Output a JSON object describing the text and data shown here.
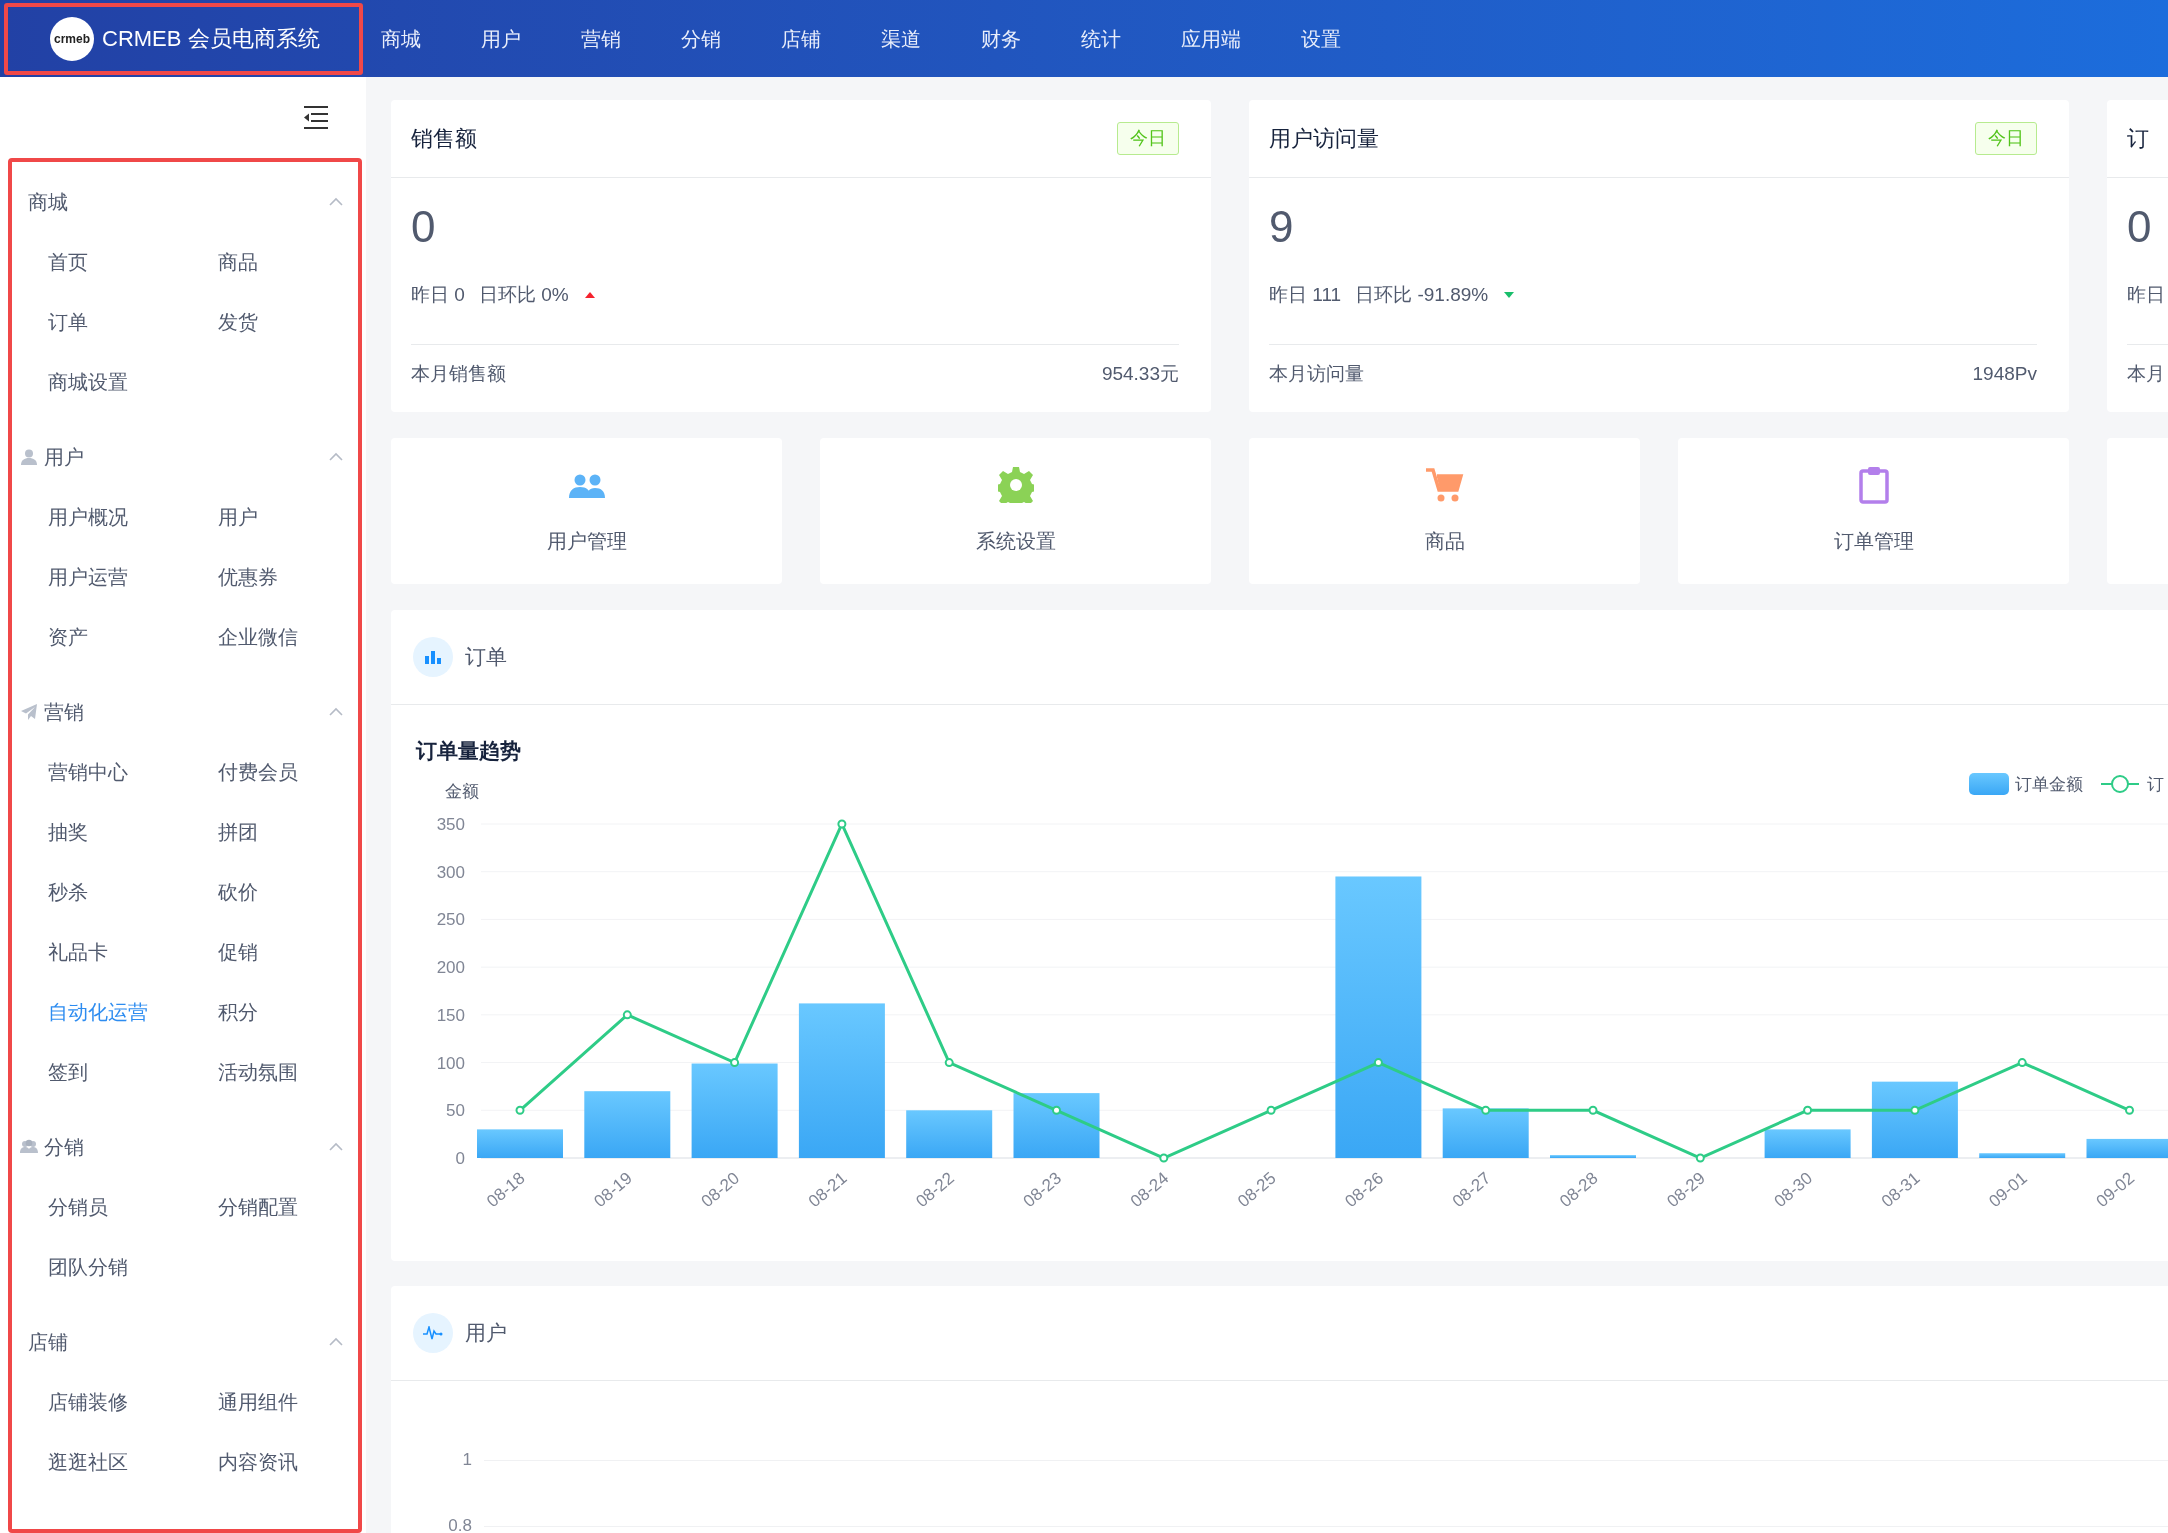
{
  "header": {
    "logo_text": "crmeb",
    "title": "CRMEB 会员电商系统",
    "highlighted": true,
    "nav": [
      "商城",
      "用户",
      "营销",
      "分销",
      "店铺",
      "渠道",
      "财务",
      "统计",
      "应用端",
      "设置"
    ]
  },
  "sidebar": {
    "highlighted": true,
    "groups": [
      {
        "title": "商城",
        "expanded": true,
        "items": [
          {
            "label": "首页",
            "selected": false
          },
          {
            "label": "商品",
            "selected": false
          },
          {
            "label": "订单",
            "selected": false
          },
          {
            "label": "发货",
            "selected": false
          },
          {
            "label": "商城设置",
            "selected": false
          }
        ]
      },
      {
        "title": "用户",
        "expanded": true,
        "items": [
          {
            "label": "用户概况",
            "selected": false
          },
          {
            "label": "用户",
            "selected": false
          },
          {
            "label": "用户运营",
            "selected": false
          },
          {
            "label": "优惠券",
            "selected": false
          },
          {
            "label": "资产",
            "selected": false
          },
          {
            "label": "企业微信",
            "selected": false
          }
        ]
      },
      {
        "title": "营销",
        "expanded": true,
        "items": [
          {
            "label": "营销中心",
            "selected": false
          },
          {
            "label": "付费会员",
            "selected": false
          },
          {
            "label": "抽奖",
            "selected": false
          },
          {
            "label": "拼团",
            "selected": false
          },
          {
            "label": "秒杀",
            "selected": false
          },
          {
            "label": "砍价",
            "selected": false
          },
          {
            "label": "礼品卡",
            "selected": false
          },
          {
            "label": "促销",
            "selected": false
          },
          {
            "label": "自动化运营",
            "selected": true
          },
          {
            "label": "积分",
            "selected": false
          },
          {
            "label": "签到",
            "selected": false
          },
          {
            "label": "活动氛围",
            "selected": false
          }
        ]
      },
      {
        "title": "分销",
        "expanded": true,
        "items": [
          {
            "label": "分销员",
            "selected": false
          },
          {
            "label": "分销配置",
            "selected": false
          },
          {
            "label": "团队分销",
            "selected": false
          }
        ]
      },
      {
        "title": "店铺",
        "expanded": true,
        "items": [
          {
            "label": "店铺装修",
            "selected": false
          },
          {
            "label": "通用组件",
            "selected": false
          },
          {
            "label": "逛逛社区",
            "selected": false
          },
          {
            "label": "内容资讯",
            "selected": false
          }
        ]
      }
    ]
  },
  "stats": [
    {
      "title": "销售额",
      "tag": "今日",
      "value": "0",
      "yesterday": "昨日 0",
      "ratio": "日环比 0%",
      "rising": true,
      "footer_label": "本月销售额",
      "footer_value": "954.33元"
    },
    {
      "title": "用户访问量",
      "tag": "今日",
      "value": "9",
      "yesterday": "昨日 111",
      "ratio": "日环比 -91.89%",
      "rising": false,
      "footer_label": "本月访问量",
      "footer_value": "1948Pv"
    },
    {
      "title": "订",
      "value": "0",
      "yesterday": "昨日",
      "footer_label": "本月"
    }
  ],
  "quick_links": [
    {
      "label": "用户管理",
      "color": "#5cb3f7"
    },
    {
      "label": "系统设置",
      "color": "#8bd256"
    },
    {
      "label": "商品",
      "color": "#ff9a6a"
    },
    {
      "label": "订单管理",
      "color": "#b37feb"
    }
  ],
  "order_section": {
    "title": "订单",
    "chart_data": {
      "type": "bar",
      "title": "订单量趋势",
      "ylabel": "金额",
      "categories": [
        "08-18",
        "08-19",
        "08-20",
        "08-21",
        "08-22",
        "08-23",
        "08-24",
        "08-25",
        "08-26",
        "08-27",
        "08-28",
        "08-29",
        "08-30",
        "08-31",
        "09-01",
        "09-02"
      ],
      "ylim": [
        0,
        350
      ],
      "grid": true,
      "legend": true,
      "yticks": [
        0,
        50,
        100,
        150,
        200,
        250,
        300,
        350
      ],
      "series": [
        {
          "name": "订单金额",
          "color": "#3aa7f5",
          "values": [
            30,
            70,
            99,
            162,
            50,
            68,
            0,
            0,
            295,
            52,
            3,
            0,
            30,
            80,
            5,
            20
          ]
        },
        {
          "name": "订",
          "type": "line",
          "marker": "circle",
          "color": "#2ecc87",
          "values": [
            50,
            150,
            100,
            350,
            100,
            50,
            0,
            50,
            100,
            50,
            50,
            0,
            50,
            50,
            100,
            50
          ]
        }
      ]
    }
  },
  "user_section": {
    "title": "用户",
    "y_labels": [
      "1",
      "0.8"
    ]
  }
}
